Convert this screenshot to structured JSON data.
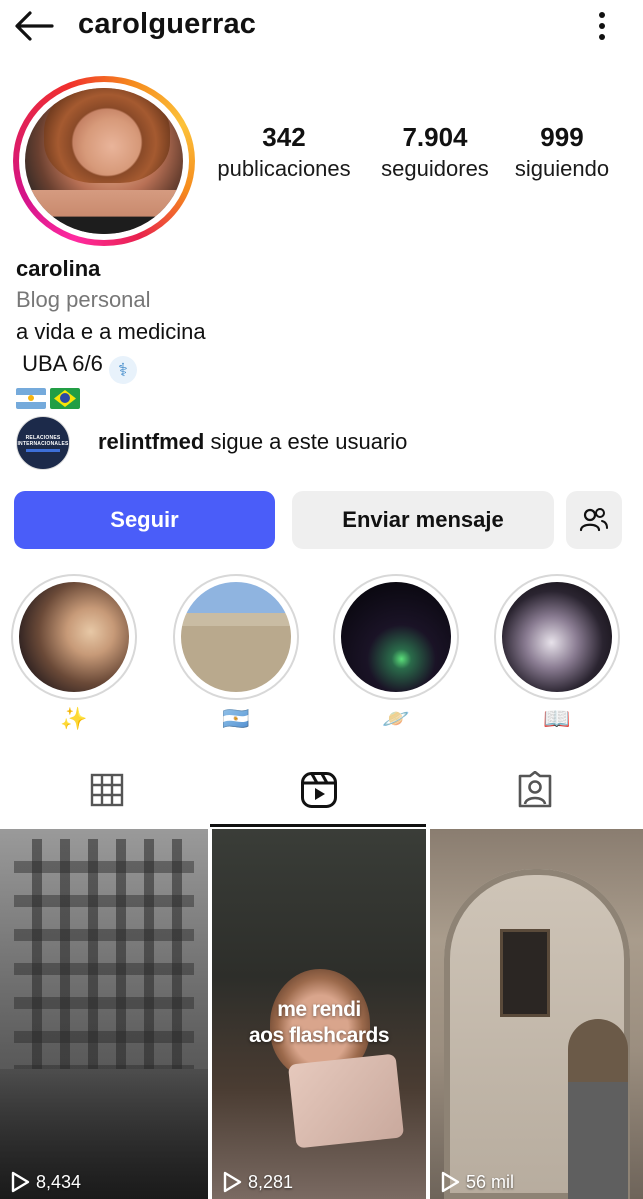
{
  "header": {
    "username": "carolguerrac",
    "back_icon": "arrow-left-icon",
    "more_icon": "more-vertical-icon"
  },
  "stats": {
    "posts": {
      "value": "342",
      "label": "publicaciones"
    },
    "followers": {
      "value": "7.904",
      "label": "seguidores"
    },
    "following": {
      "value": "999",
      "label": "siguiendo"
    }
  },
  "bio": {
    "name": "carolina",
    "category": "Blog personal",
    "line1": "a vida e a medicina",
    "line2": " UBA 6/6",
    "line2_emoji": "⚕"
  },
  "mutual": {
    "account": "relintfmed",
    "text": " sigue a este usuario",
    "avatar_line1": "RELACIONES",
    "avatar_line2": "INTERNACIONALES"
  },
  "actions": {
    "follow": "Seguir",
    "message": "Enviar mensaje"
  },
  "highlights": [
    {
      "emoji": "✨"
    },
    {
      "emoji": "🇦🇷"
    },
    {
      "emoji": "🪐"
    },
    {
      "emoji": "📖"
    }
  ],
  "reels": [
    {
      "views": "8,434",
      "overlay": ""
    },
    {
      "views": "8,281",
      "overlay_line1": "me rendi",
      "overlay_line2": "aos flashcards"
    },
    {
      "views": "56 mil",
      "overlay": ""
    }
  ],
  "colors": {
    "follow_button": "#4a5df9",
    "secondary_button": "#efefef",
    "category_text": "#777777"
  }
}
